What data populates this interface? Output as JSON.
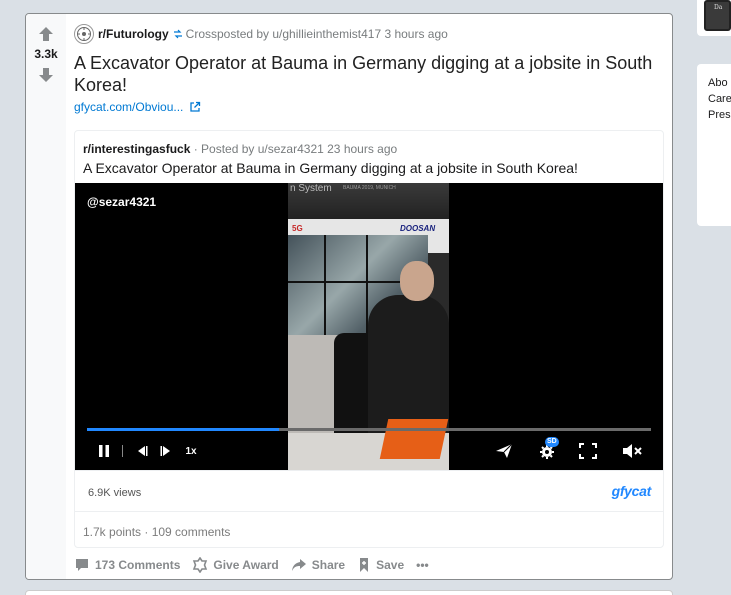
{
  "post": {
    "score": "3.3k",
    "subreddit": "r/Futurology",
    "crossposted_by": "Crossposted by u/ghillieinthemist417 3 hours ago",
    "title": "A Excavator Operator at Bauma in Germany digging at a jobsite in South Korea!",
    "link_text": "gfycat.com/Obviou..."
  },
  "embed": {
    "subreddit": "r/interestingasfuck",
    "posted_by": "· Posted by u/sezar4321 23 hours ago",
    "title": "A Excavator Operator at Bauma in Germany digging at a jobsite in South Korea!",
    "stats": "1.7k points · 109 comments"
  },
  "video": {
    "watermark": "@sezar4321",
    "progress": 0.34,
    "speed_label": "1x",
    "quality_badge": "SD",
    "frame_text_1": "n System",
    "frame_text_2": "BAUMA 2019, MUNICH",
    "frame_logo_left": "5G",
    "frame_logo_right": "DOOSAN",
    "views": "6.9K views",
    "provider_logo": "gfycat",
    "accent_color": "#2188ff"
  },
  "actions": {
    "comments": "173 Comments",
    "award": "Give Award",
    "share": "Share",
    "save": "Save",
    "more": "•••"
  },
  "sidebar": {
    "links": [
      "Abo",
      "Care",
      "Pres"
    ],
    "thumb_text": "Da"
  },
  "icons": [
    "upvote-icon",
    "downvote-icon",
    "crosspost-icon",
    "external-link-icon",
    "pause-icon",
    "prev-frame-icon",
    "next-frame-icon",
    "send-icon",
    "settings-icon",
    "fullscreen-icon",
    "mute-icon",
    "comment-icon",
    "award-icon",
    "share-icon",
    "save-icon"
  ]
}
